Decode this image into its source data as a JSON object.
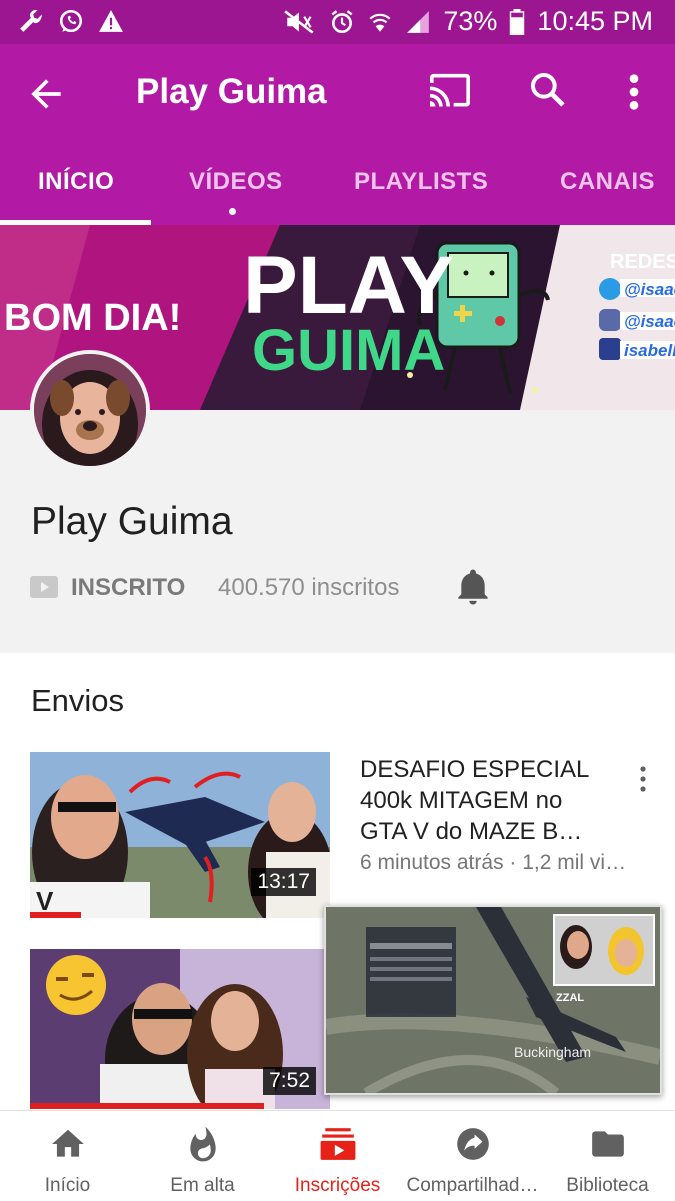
{
  "status_bar": {
    "battery": "73%",
    "time": "10:45 PM",
    "icons_left": [
      "wrench-icon",
      "whatsapp-icon",
      "warning-icon"
    ],
    "icons_right": [
      "mute-icon",
      "alarm-icon",
      "wifi-icon",
      "signal-icon",
      "battery-icon"
    ]
  },
  "app_bar": {
    "title": "Play Guima",
    "actions": [
      "back-arrow-icon",
      "cast-icon",
      "search-icon",
      "more-vert-icon"
    ]
  },
  "tabs": [
    {
      "label": "INÍCIO",
      "active": true
    },
    {
      "label": "VÍDEOS",
      "active": false,
      "has_dot": true
    },
    {
      "label": "PLAYLISTS",
      "active": false
    },
    {
      "label": "CANAIS",
      "active": false
    }
  ],
  "banner": {
    "greeting": "BOM DIA!",
    "logo_line1": "PLAY",
    "logo_line2": "GUIMA",
    "social_title": "REDES",
    "handles": [
      "@isaac",
      "@isaac",
      "isabell"
    ]
  },
  "channel": {
    "name": "Play Guima",
    "subscribe_label": "INSCRITO",
    "subscriber_count": "400.570 inscritos"
  },
  "uploads": {
    "title": "Envios",
    "videos": [
      {
        "title": "DESAFIO ESPECIAL 400k MITAGEM no GTA V do MAZE B…",
        "meta": "6 minutos atrás · 1,2 mil vi…",
        "duration": "13:17",
        "watched_fraction": 0.17
      },
      {
        "title": "",
        "meta": "",
        "duration": "7:52",
        "watched_fraction": 0.78
      }
    ]
  },
  "mini_player": {
    "overlay_text": "Buckingham",
    "tag": "ZZAL"
  },
  "bottom_nav": [
    {
      "label": "Início",
      "icon": "home-icon",
      "active": false
    },
    {
      "label": "Em alta",
      "icon": "fire-icon",
      "active": false
    },
    {
      "label": "Inscrições",
      "icon": "subscriptions-icon",
      "active": true
    },
    {
      "label": "Compartilhad…",
      "icon": "share-icon",
      "active": false
    },
    {
      "label": "Biblioteca",
      "icon": "folder-icon",
      "active": false
    }
  ],
  "colors": {
    "brand": "#b21aa5",
    "status_bar": "#9c1591",
    "active_nav": "#e62117"
  }
}
